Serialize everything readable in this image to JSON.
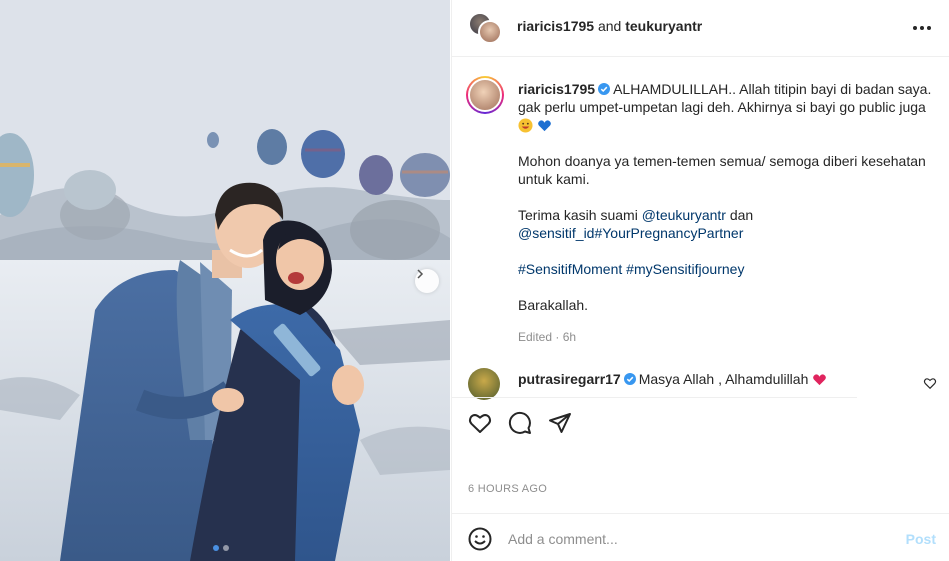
{
  "header": {
    "user1": "riaricis1795",
    "joiner": "and",
    "user2": "teukuryantr"
  },
  "caption": {
    "username": "riaricis1795",
    "line1": "ALHAMDULILLAH.. Allah titipin bayi di badan saya. gak perlu umpet-umpetan lagi deh. Akhirnya si bayi go public juga",
    "para2": "Mohon doanya ya temen-temen semua/ semoga diberi kesehatan untuk kami.",
    "para3_prefix": "Terima kasih suami",
    "para3_mention1": "@teukuryantr",
    "para3_mid": "dan",
    "para3_mention2": "@sensitif_id",
    "para3_hashtag": "#YourPregnancyPartner",
    "hashtag1": "#SensitifMoment",
    "hashtag2": "#mySensitifjourney",
    "closing": "Barakallah.",
    "edited": "Edited · 6h"
  },
  "comment": {
    "username": "putrasiregarr17",
    "text": "Masya Allah , Alhamdulillah"
  },
  "timestamp": "6 HOURS AGO",
  "comment_bar": {
    "placeholder": "Add a comment...",
    "post_label": "Post"
  },
  "icons": {
    "more": "more-horizontal-icon",
    "verified": "verified-badge-icon",
    "like": "heart-icon",
    "comment": "comment-icon",
    "share": "share-icon",
    "emoji": "emoji-icon",
    "carousel_next": "chevron-right-icon"
  },
  "colors": {
    "link": "#00376b",
    "verified": "#3897f0",
    "post_disabled": "#b2dffc",
    "heart_red": "#ed4956"
  },
  "carousel": {
    "current": 1,
    "total": 2
  }
}
